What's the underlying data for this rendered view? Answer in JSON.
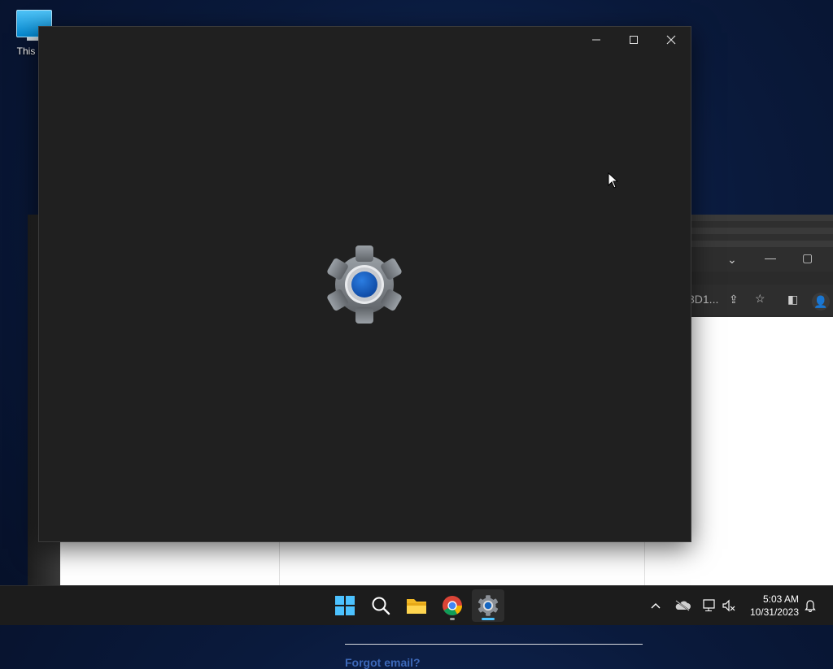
{
  "desktop": {
    "icon_label": "This PC"
  },
  "browser_bg": {
    "url_fragment": "3D1...",
    "forgot_email_link": "Forgot email?"
  },
  "settings_window": {
    "app_icon": "settings-gear-icon",
    "accent": "#1565c0",
    "background": "#202020"
  },
  "taskbar": {
    "apps": [
      {
        "name": "Start",
        "icon": "windows-logo-icon"
      },
      {
        "name": "Search",
        "icon": "search-icon"
      },
      {
        "name": "File Explorer",
        "icon": "folder-icon"
      },
      {
        "name": "Google Chrome",
        "icon": "chrome-icon"
      },
      {
        "name": "Settings",
        "icon": "settings-gear-icon",
        "active": true
      }
    ],
    "time": "5:03 AM",
    "date": "10/31/2023"
  }
}
